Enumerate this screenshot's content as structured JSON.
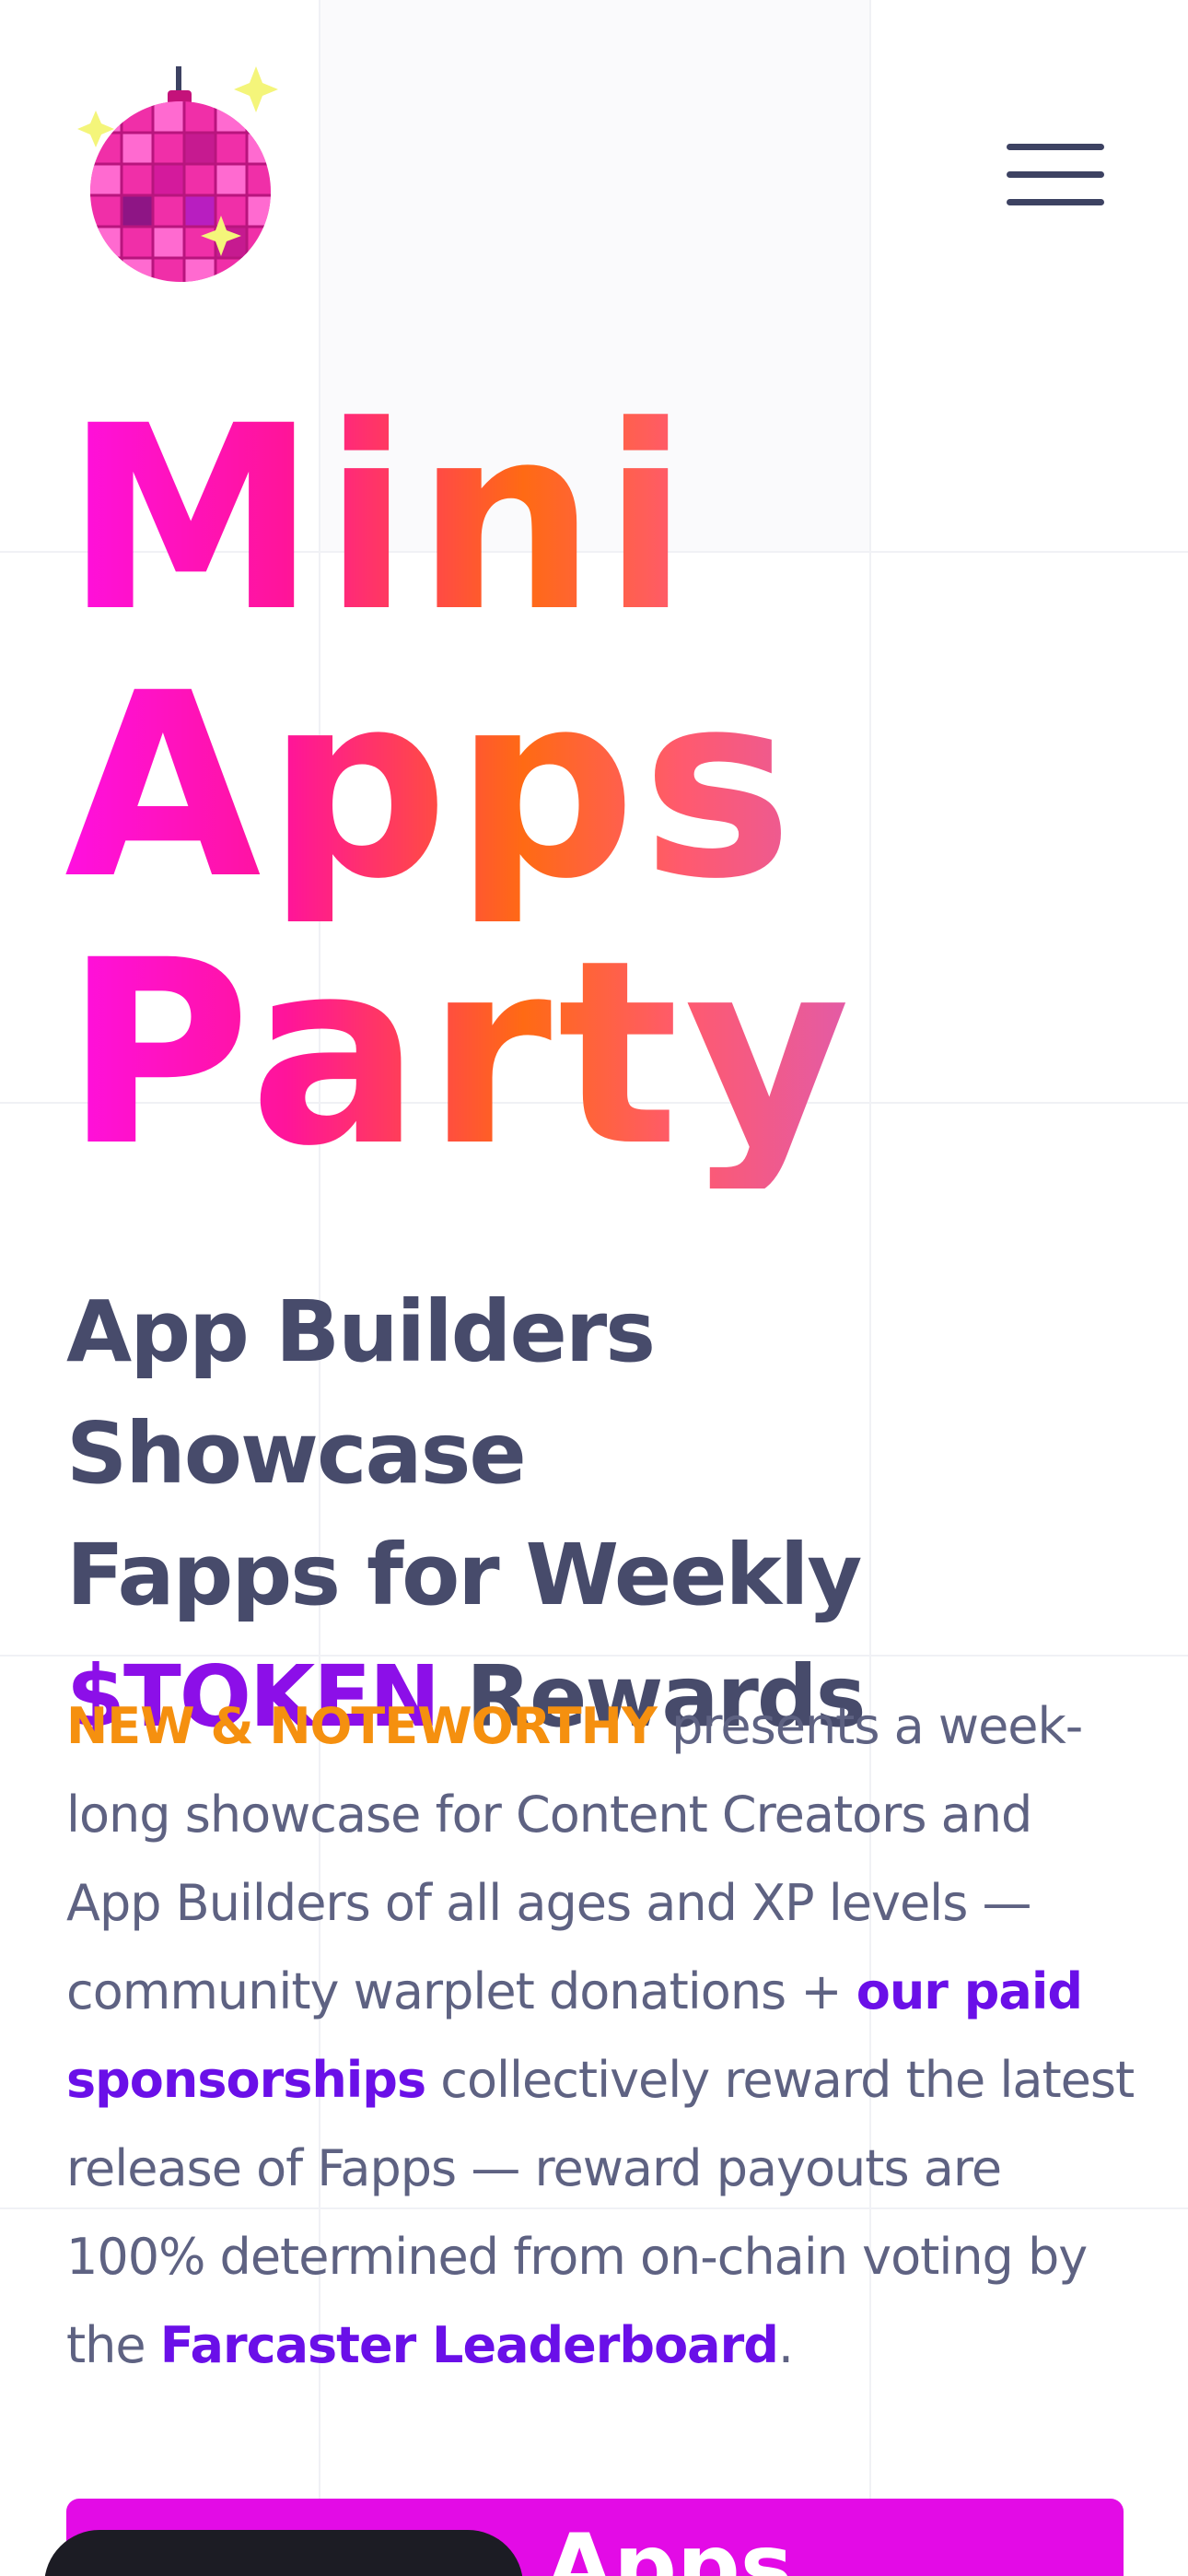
{
  "header": {
    "logo_icon": "disco-ball-icon",
    "menu_icon": "hamburger-menu-icon"
  },
  "hero": {
    "lines": [
      "Mini",
      "Apps",
      "Party"
    ]
  },
  "subtitle": {
    "line1": "App Builders Showcase",
    "line2": "Fapps for Weekly",
    "token": "$TOKEN",
    "rewards": " Rewards"
  },
  "body": {
    "highlight": "NEW & NOTEWORTHY",
    "text1": " presents a week-long showcase for Content Creators and App Builders of all ages and XP levels — community warplet donations + ",
    "link_sponsorships": "our paid sponsorships",
    "text2": " collectively reward the latest release of Fapps — reward payouts are 100% determined from on-chain voting by the ",
    "link_leaderboard": "Farcaster Leaderboard",
    "text3": "."
  },
  "cta": {
    "label": "Apps"
  },
  "colors": {
    "accent_magenta": "#e30be6",
    "token_purple": "#8c0fe8",
    "link_purple": "#6a0fe8",
    "highlight_orange": "#f5900f",
    "text_slate": "#474b6b"
  }
}
